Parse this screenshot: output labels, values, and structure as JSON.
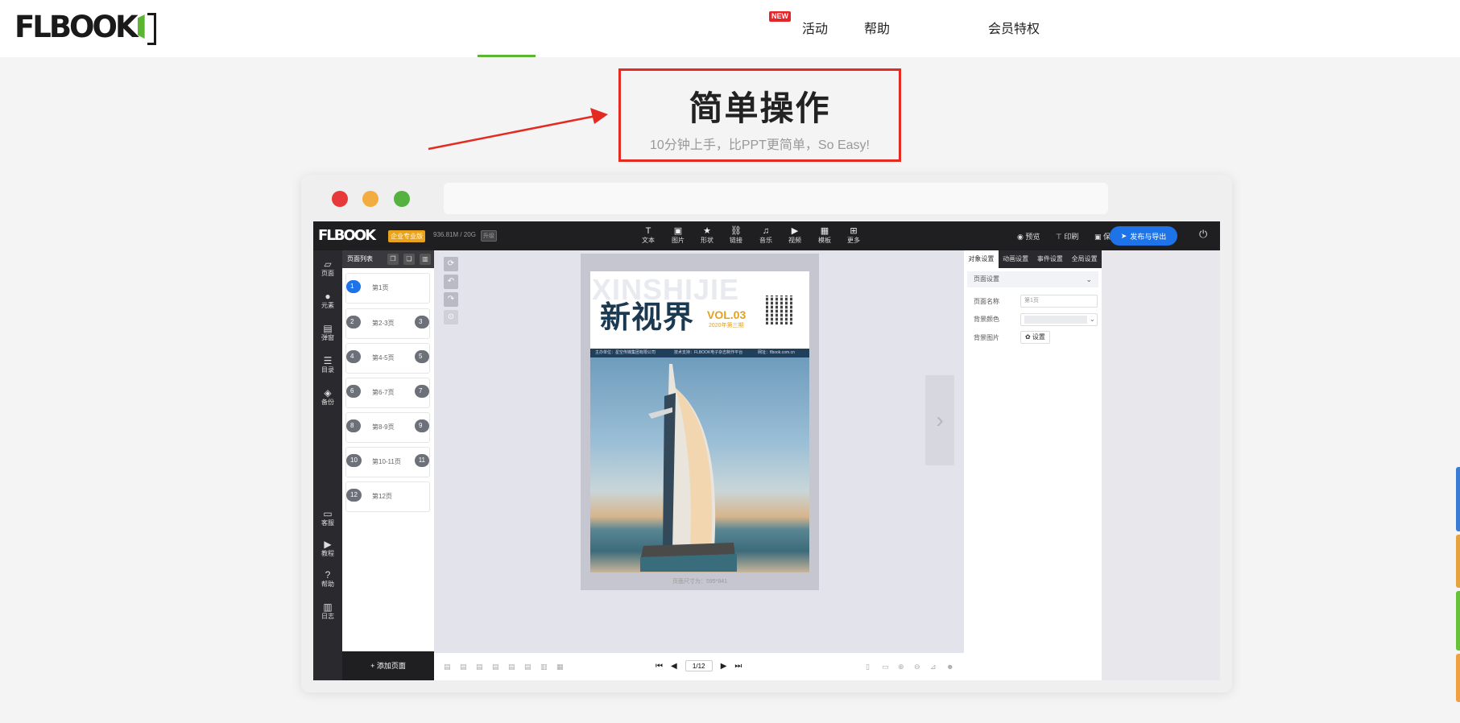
{
  "nav": {
    "new_badge": "NEW",
    "items": [
      "活动",
      "帮助",
      "会员特权"
    ],
    "logo": "FLBOOK"
  },
  "headline": {
    "title": "简单操作",
    "subtitle": "10分钟上手，比PPT更简单，So Easy!"
  },
  "editor": {
    "logo": "FLBOOK",
    "plan_badge": "企业专业版",
    "storage": "936.81M / 20G",
    "upgrade": "升级",
    "tools": [
      {
        "icon": "T",
        "label": "文本"
      },
      {
        "icon": "▣",
        "label": "图片"
      },
      {
        "icon": "★",
        "label": "形状"
      },
      {
        "icon": "⛓",
        "label": "链接"
      },
      {
        "icon": "♫",
        "label": "音乐"
      },
      {
        "icon": "▶",
        "label": "视频"
      },
      {
        "icon": "▦",
        "label": "模板"
      },
      {
        "icon": "⊞",
        "label": "更多"
      }
    ],
    "preview": "预览",
    "print": "印刷",
    "save": "保存",
    "publish": "发布与导出",
    "left_nav": [
      {
        "icon": "▱",
        "label": "页面"
      },
      {
        "icon": "●",
        "label": "元素"
      },
      {
        "icon": "▤",
        "label": "弹窗"
      },
      {
        "icon": "☰",
        "label": "目录"
      },
      {
        "icon": "◈",
        "label": "备份"
      },
      {
        "icon": "▭",
        "label": "客服"
      },
      {
        "icon": "▶",
        "label": "教程"
      },
      {
        "icon": "?",
        "label": "帮助"
      },
      {
        "icon": "▥",
        "label": "日志"
      }
    ],
    "pages_header": "页面列表",
    "pages": [
      {
        "left": "1",
        "right": "",
        "label": "第1页"
      },
      {
        "left": "2",
        "right": "3",
        "label": "第2-3页"
      },
      {
        "left": "4",
        "right": "5",
        "label": "第4-5页"
      },
      {
        "left": "6",
        "right": "7",
        "label": "第6-7页"
      },
      {
        "left": "8",
        "right": "9",
        "label": "第8-9页"
      },
      {
        "left": "10",
        "right": "11",
        "label": "第10-11页"
      },
      {
        "left": "12",
        "right": "",
        "label": "第12页"
      }
    ],
    "add_page": "+ 添加页面",
    "document": {
      "ghost_text": "XINSHIJIE",
      "title": "新视界",
      "vol": "VOL.03",
      "issue": "2020年第三期",
      "strip_items": [
        "主办单位：星空传媒集团有限公司",
        "技术支持：FLBOOK电子杂志制作平台",
        "网址：flbook.com.cn"
      ],
      "size_label": "页面尺寸为：595*841"
    },
    "pager": "1/12",
    "right_tabs": [
      "对象设置",
      "动画设置",
      "事件设置",
      "全局设置"
    ],
    "section_title": "页面设置",
    "page_name_label": "页面名称",
    "page_name_value": "第1页",
    "bg_color_label": "背景颜色",
    "bg_image_label": "背景图片",
    "settings_btn": "✿ 设置"
  },
  "colors": {
    "accent_green": "#5bb432",
    "highlight_red": "#e32b22",
    "publish_blue": "#1e73e8"
  }
}
